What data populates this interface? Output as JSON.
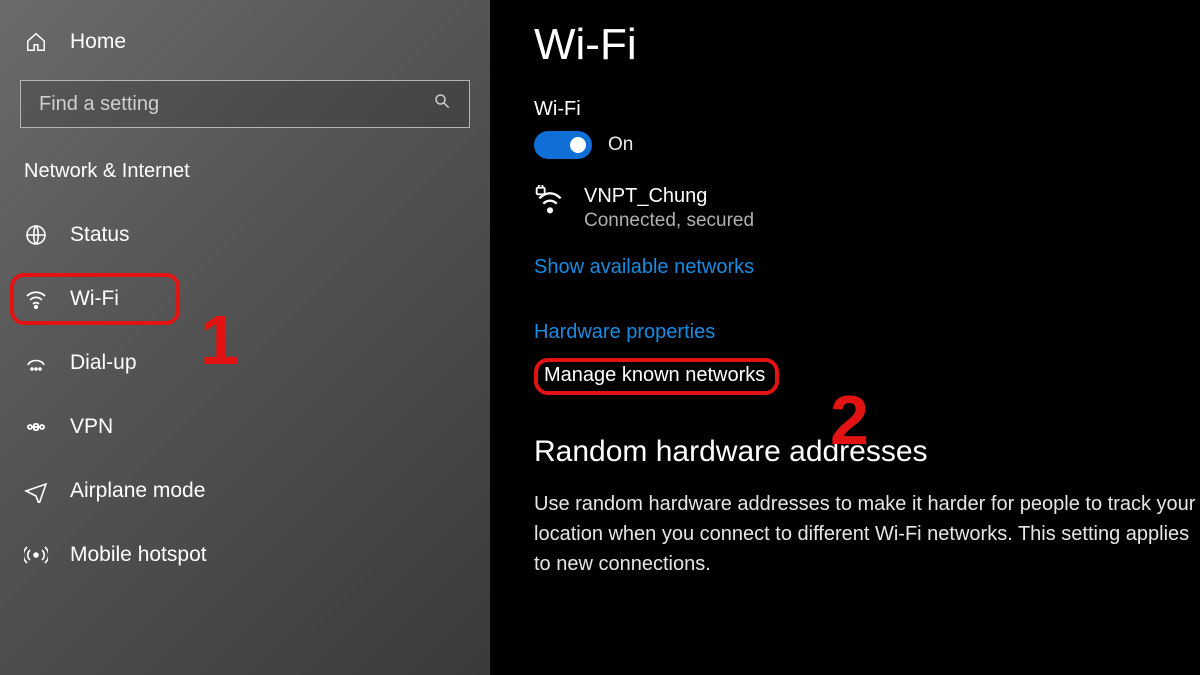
{
  "sidebar": {
    "home": "Home",
    "search_placeholder": "Find a setting",
    "section": "Network & Internet",
    "items": [
      {
        "label": "Status"
      },
      {
        "label": "Wi-Fi"
      },
      {
        "label": "Dial-up"
      },
      {
        "label": "VPN"
      },
      {
        "label": "Airplane mode"
      },
      {
        "label": "Mobile hotspot"
      }
    ]
  },
  "annotations": {
    "one": "1",
    "two": "2"
  },
  "main": {
    "title": "Wi-Fi",
    "wifi_label": "Wi-Fi",
    "toggle_state": "On",
    "network": {
      "name": "VNPT_Chung",
      "status": "Connected, secured"
    },
    "links": {
      "show_available": "Show available networks",
      "hardware_props": "Hardware properties",
      "manage_known": "Manage known networks"
    },
    "random_hw": {
      "heading": "Random hardware addresses",
      "desc": "Use random hardware addresses to make it harder for people to track your location when you connect to different Wi-Fi networks. This setting applies to new connections."
    }
  }
}
